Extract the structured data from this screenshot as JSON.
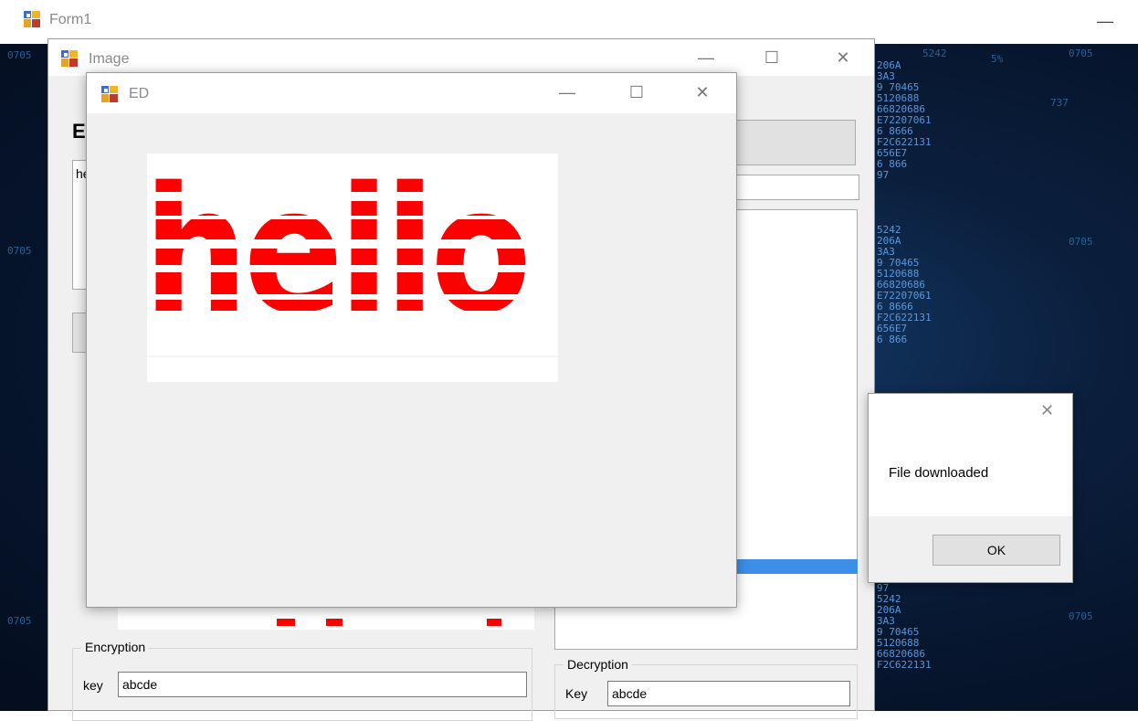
{
  "form1": {
    "title": "Form1",
    "minimize_glyph": "—"
  },
  "image_window": {
    "title": "Image",
    "heading_partial": "E",
    "textbox_partial": "he",
    "encryption": {
      "group_label": "Encryption",
      "key_label": "key",
      "key_value": "abcde"
    },
    "decryption": {
      "group_label": "Decryption",
      "key_label": "Key",
      "key_value": "abcde"
    }
  },
  "ed_window": {
    "title": "ED",
    "image_text": "hello",
    "image_color": "#ff0000"
  },
  "message_box": {
    "message": "File downloaded",
    "ok_label": "OK"
  },
  "window_controls": {
    "minimize": "—",
    "maximize": "☐",
    "close": "✕"
  },
  "background_glyphs": [
    "5242",
    "0705",
    "5%",
    "0705",
    "737",
    "206A",
    "3A3",
    "9 70465",
    "5120688",
    "66820686",
    "E72207061",
    "6 8666",
    "F2C622131",
    "656E7",
    "6 866",
    "97"
  ],
  "colors": {
    "accent_selection": "#3d8ee8",
    "matrix_dark": "#06142b"
  }
}
